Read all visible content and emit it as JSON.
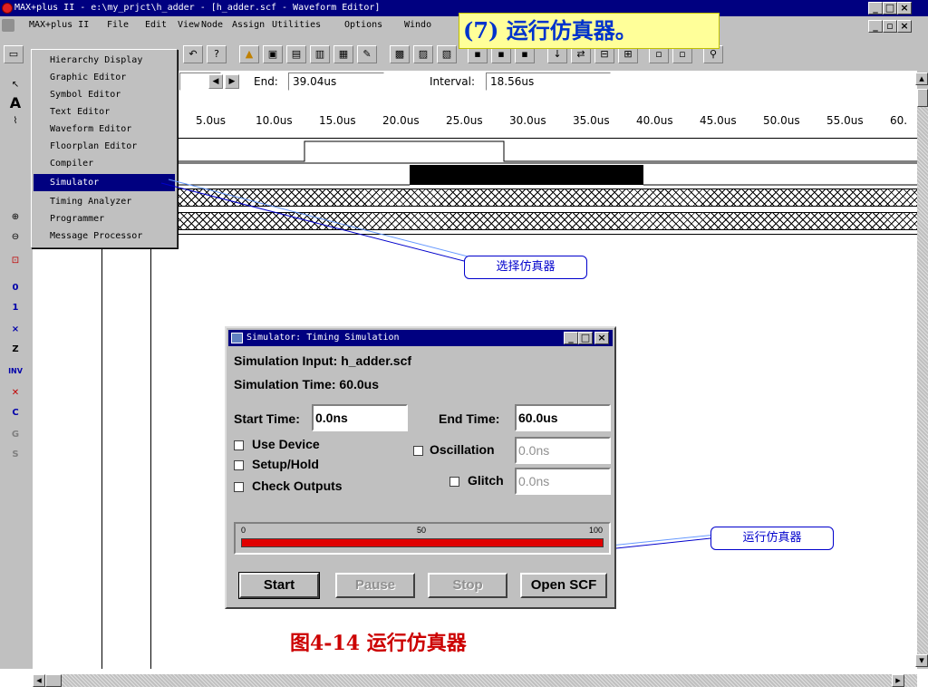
{
  "window": {
    "title": "MAX+plus II - e:\\my_prjct\\h_adder - [h_adder.scf - Waveform Editor]",
    "controls": [
      "_",
      "□",
      "×"
    ],
    "mdi_controls": [
      "_",
      "▫",
      "×"
    ]
  },
  "menubar": {
    "items": [
      "MAX+plus II",
      "File",
      "Edit",
      "View",
      "Node",
      "Assign",
      "Utilities",
      "Options",
      "Windo"
    ]
  },
  "callout": {
    "text": "(7) 运行仿真器。"
  },
  "dropdown": {
    "items": [
      {
        "label": "Hierarchy Display",
        "selected": false
      },
      {
        "label": "Graphic Editor",
        "selected": false
      },
      {
        "label": "Symbol Editor",
        "selected": false
      },
      {
        "label": "Text Editor",
        "selected": false
      },
      {
        "label": "Waveform Editor",
        "selected": false
      },
      {
        "label": "Floorplan Editor",
        "selected": false
      },
      {
        "label": "Compiler",
        "selected": false
      },
      {
        "label": "Simulator",
        "selected": true
      },
      {
        "label": "Timing Analyzer",
        "selected": false
      },
      {
        "label": "Programmer",
        "selected": false
      },
      {
        "label": "Message Processor",
        "selected": false
      }
    ]
  },
  "waveform": {
    "end_label": "End:",
    "end_value": "39.04us",
    "interval_label": "Interval:",
    "interval_value": "18.56us",
    "ticks": [
      "5.0us",
      "10.0us",
      "15.0us",
      "20.0us",
      "25.0us",
      "30.0us",
      "35.0us",
      "40.0us",
      "45.0us",
      "50.0us",
      "55.0us",
      "60."
    ]
  },
  "annotations": {
    "select_simulator": "选择仿真器",
    "run_simulator": "运行仿真器"
  },
  "dialog": {
    "title": "Simulator: Timing Simulation",
    "simulation_input": "Simulation Input: h_adder.scf",
    "simulation_time": "Simulation Time: 60.0us",
    "start_time_label": "Start Time:",
    "start_time_value": "0.0ns",
    "end_time_label": "End Time:",
    "end_time_value": "60.0us",
    "use_device": "Use Device",
    "setup_hold": "Setup/Hold",
    "check_outputs": "Check Outputs",
    "oscillation": "Oscillation",
    "oscillation_value": "0.0ns",
    "glitch": "Glitch",
    "glitch_value": "0.0ns",
    "progress_labels": [
      "0",
      "50",
      "100"
    ],
    "progress_fraction": 1.0,
    "progress_color": "#e00000",
    "buttons": {
      "start": "Start",
      "pause": "Pause",
      "stop": "Stop",
      "open_scf": "Open SCF"
    }
  },
  "caption": "图4-14  运行仿真器",
  "colors": {
    "titlebar": "#000080",
    "accent_annotation": "#0000cc",
    "caption": "#cc0000",
    "callout_bg": "#ffff99"
  }
}
